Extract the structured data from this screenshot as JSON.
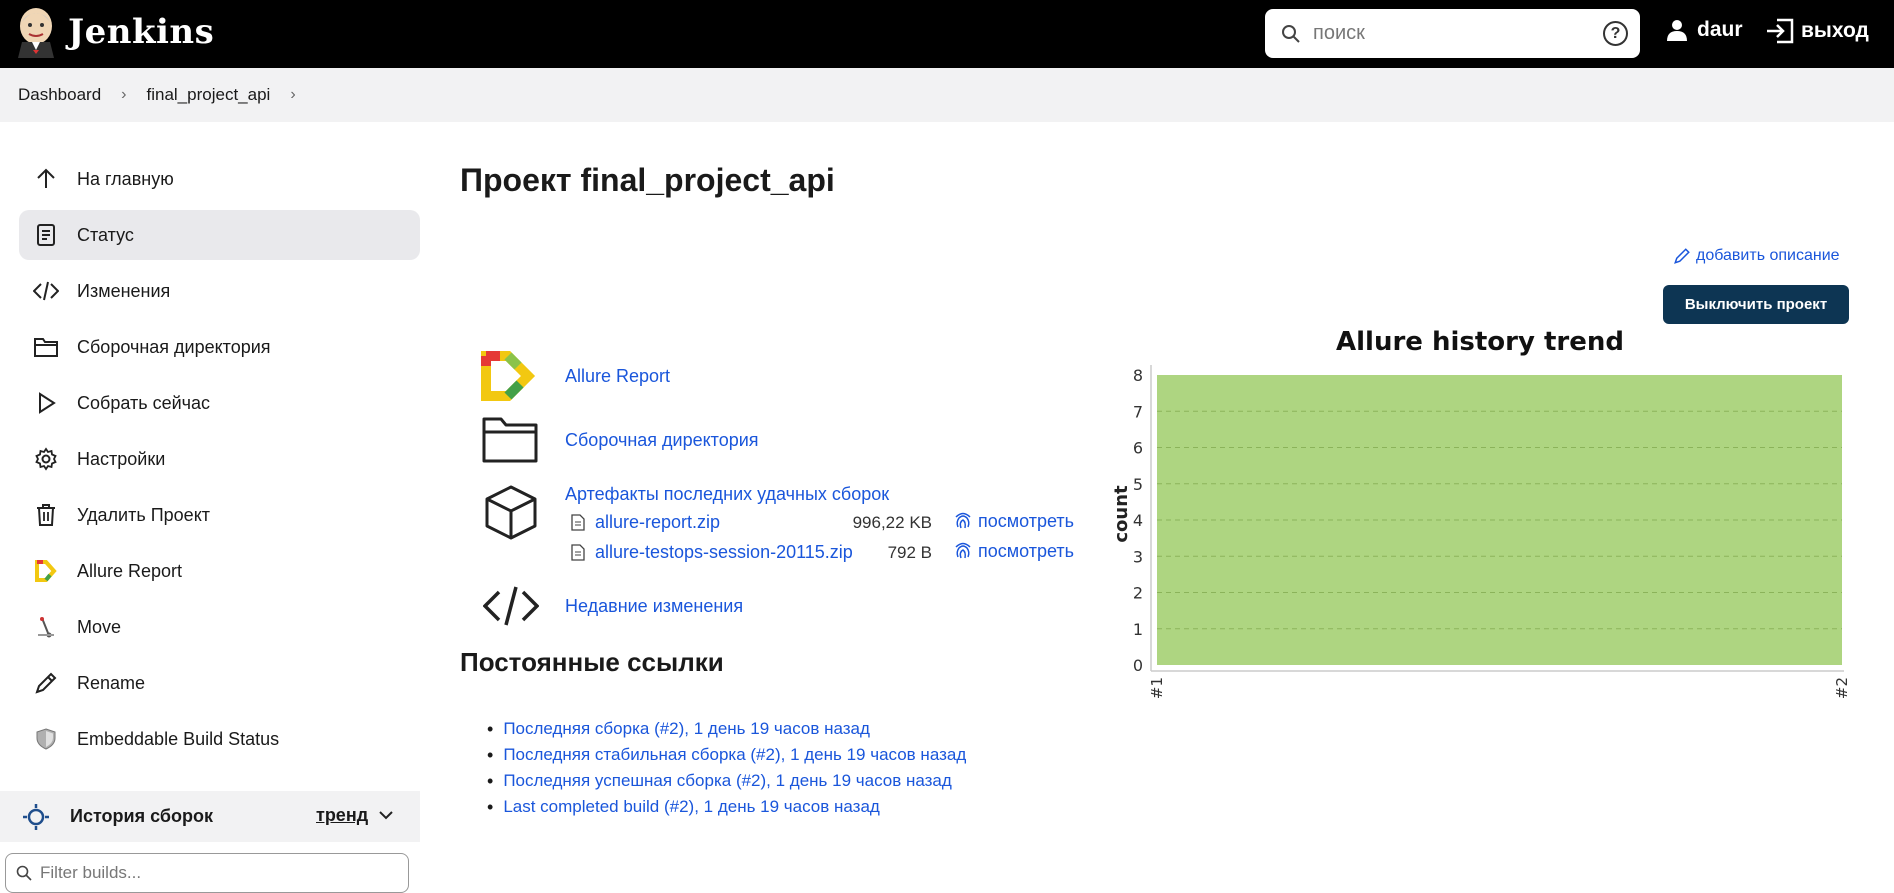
{
  "header": {
    "brand": "Jenkins",
    "search_placeholder": "поиск",
    "help": "?",
    "user": "daur",
    "logout": "выход"
  },
  "breadcrumb": {
    "items": [
      "Dashboard",
      "final_project_api"
    ]
  },
  "sidebar": {
    "items": [
      {
        "label": "На главную",
        "icon": "arrow-up-icon"
      },
      {
        "label": "Статус",
        "icon": "document-icon"
      },
      {
        "label": "Изменения",
        "icon": "code-icon"
      },
      {
        "label": "Сборочная директория",
        "icon": "folder-icon"
      },
      {
        "label": "Собрать сейчас",
        "icon": "play-icon"
      },
      {
        "label": "Настройки",
        "icon": "gear-icon"
      },
      {
        "label": "Удалить Проект",
        "icon": "trash-icon"
      },
      {
        "label": "Allure Report",
        "icon": "allure-icon"
      },
      {
        "label": "Move",
        "icon": "move-icon"
      },
      {
        "label": "Rename",
        "icon": "pencil-icon"
      },
      {
        "label": "Embeddable Build Status",
        "icon": "shield-icon"
      }
    ],
    "history_title": "История сборок",
    "history_trend": "тренд",
    "filter_placeholder": "Filter builds..."
  },
  "main": {
    "title": "Проект final_project_api",
    "add_description": "добавить описание",
    "disable_button": "Выключить проект",
    "allure_report": "Allure Report",
    "workspace": "Сборочная директория",
    "artifacts_title": "Артефакты последних удачных сборок",
    "artifacts": [
      {
        "name": "allure-report.zip",
        "size": "996,22 KB",
        "view": "посмотреть"
      },
      {
        "name": "allure-testops-session-20115.zip",
        "size": "792 B",
        "view": "посмотреть"
      }
    ],
    "recent_changes": "Недавние изменения",
    "permalinks_title": "Постоянные ссылки",
    "permalinks": [
      "Последняя сборка (#2), 1 день 19 часов назад",
      "Последняя стабильная сборка (#2), 1 день 19 часов назад",
      "Последняя успешная сборка (#2), 1 день 19 часов назад",
      "Last completed build (#2), 1 день 19 часов назад"
    ]
  },
  "colors": {
    "header_bg": "#000000",
    "button_bg": "#0d3553",
    "link": "#1a56db",
    "chart_fill": "#aed581"
  },
  "chart_data": {
    "type": "area",
    "title": "Allure history trend",
    "ylabel": "count",
    "xlabel": "",
    "x": [
      "#1",
      "#2"
    ],
    "series": [
      {
        "values": [
          8,
          8
        ]
      }
    ],
    "ylim": [
      0,
      8
    ],
    "yticks": [
      "0",
      "1",
      "2",
      "3",
      "4",
      "5",
      "6",
      "7",
      "8"
    ],
    "grid": true
  }
}
